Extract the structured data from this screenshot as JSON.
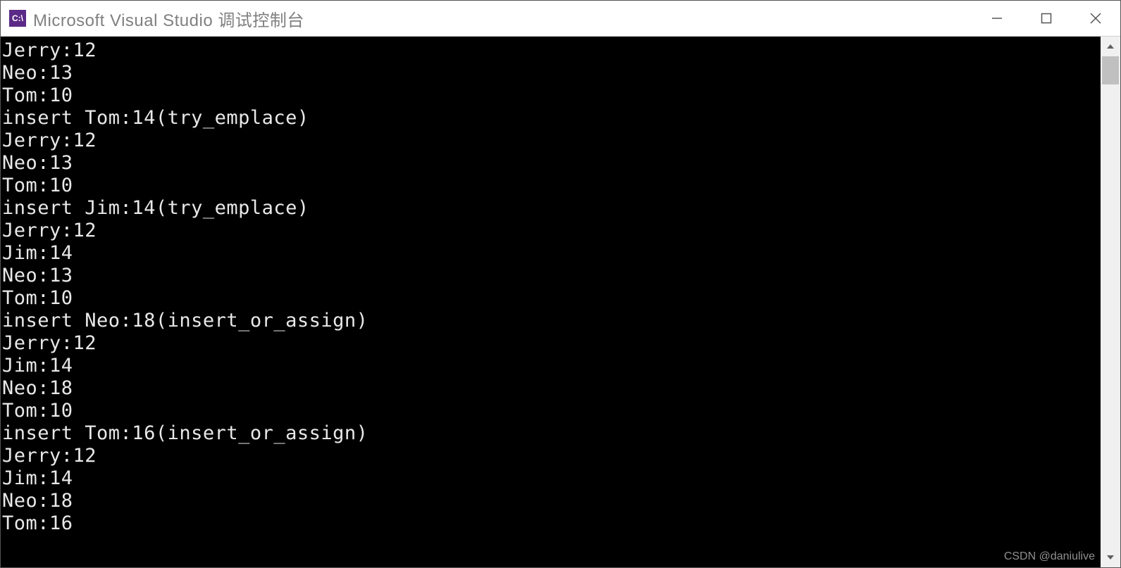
{
  "window": {
    "title": "Microsoft Visual Studio 调试控制台",
    "app_icon_label": "C:\\"
  },
  "console": {
    "lines": [
      "Jerry:12",
      "Neo:13",
      "Tom:10",
      "insert Tom:14(try_emplace)",
      "Jerry:12",
      "Neo:13",
      "Tom:10",
      "insert Jim:14(try_emplace)",
      "Jerry:12",
      "Jim:14",
      "Neo:13",
      "Tom:10",
      "insert Neo:18(insert_or_assign)",
      "Jerry:12",
      "Jim:14",
      "Neo:18",
      "Tom:10",
      "insert Tom:16(insert_or_assign)",
      "Jerry:12",
      "Jim:14",
      "Neo:18",
      "Tom:16"
    ]
  },
  "watermark": "CSDN @daniulive"
}
